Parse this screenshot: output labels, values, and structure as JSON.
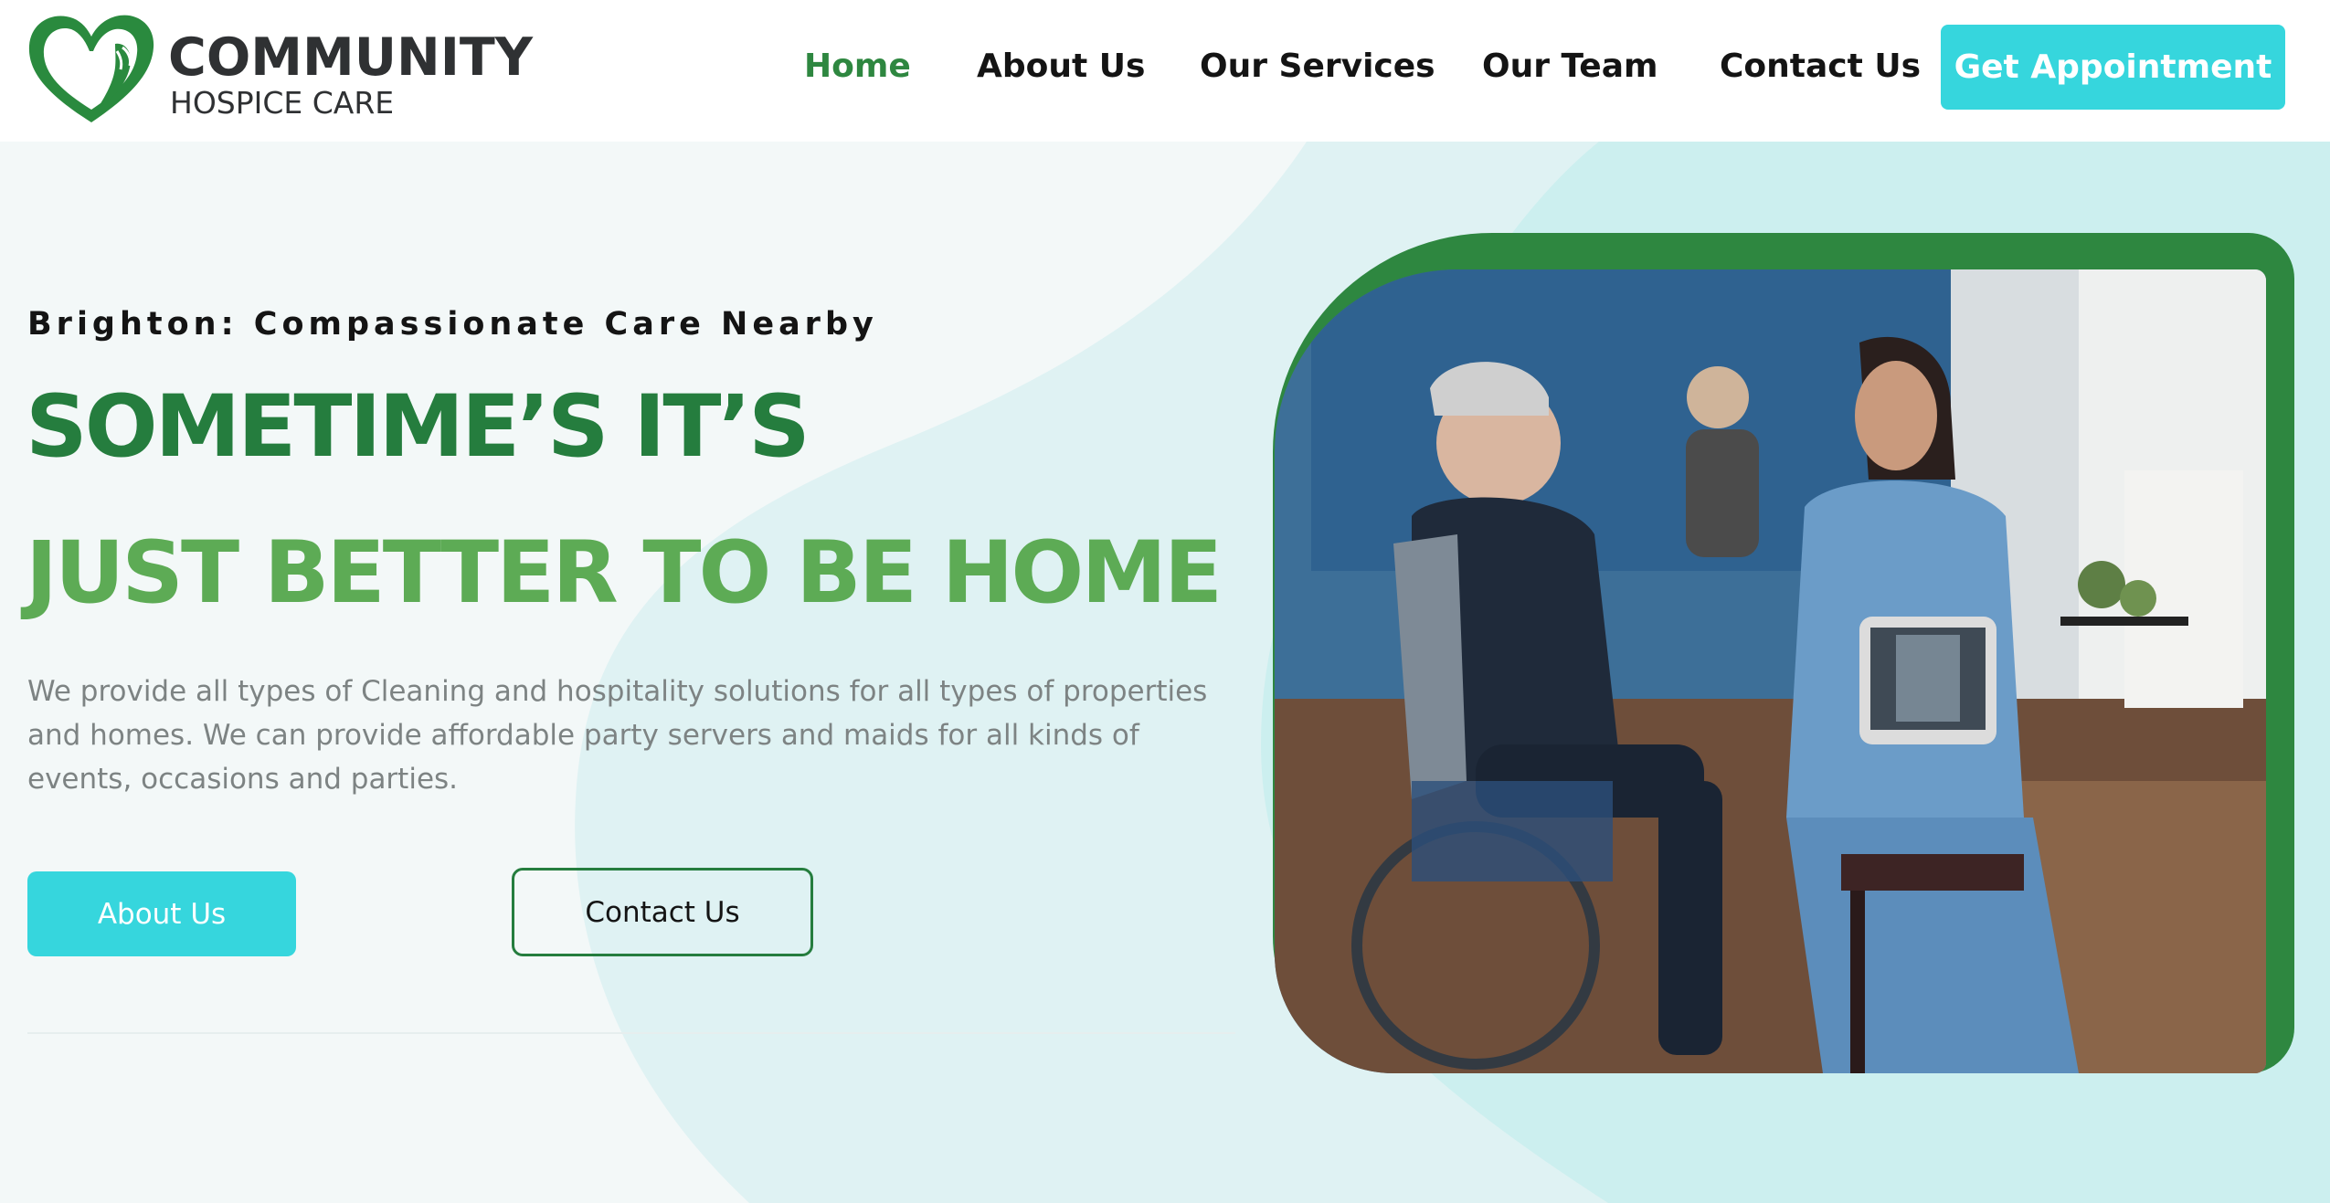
{
  "brand": {
    "name_line1": "COMMUNITY",
    "name_line2": "HOSPICE CARE",
    "colors": {
      "green": "#2e8740",
      "light_green": "#5dab55",
      "teal": "#36d6dd",
      "heart_dark": "#257d3e"
    }
  },
  "nav": {
    "items": [
      {
        "label": "Home",
        "active": true
      },
      {
        "label": "About Us",
        "active": false
      },
      {
        "label": "Our Services",
        "active": false
      },
      {
        "label": "Our Team",
        "active": false
      },
      {
        "label": "Contact Us",
        "active": false
      }
    ],
    "cta_label": "Get Appointment"
  },
  "hero": {
    "kicker": "Brighton: Compassionate Care Nearby",
    "headline_line1": "SOMETIME’S IT’S",
    "headline_line2": "JUST BETTER TO BE HOME",
    "lead": "We provide all types of Cleaning and hospitality solutions for all types of properties and homes. We can provide affordable party servers and maids for all kinds of events, occasions and parties.",
    "primary_button": "About Us",
    "secondary_button": "Contact Us",
    "image_icon": "nurse-with-elderly-patient-photo"
  }
}
